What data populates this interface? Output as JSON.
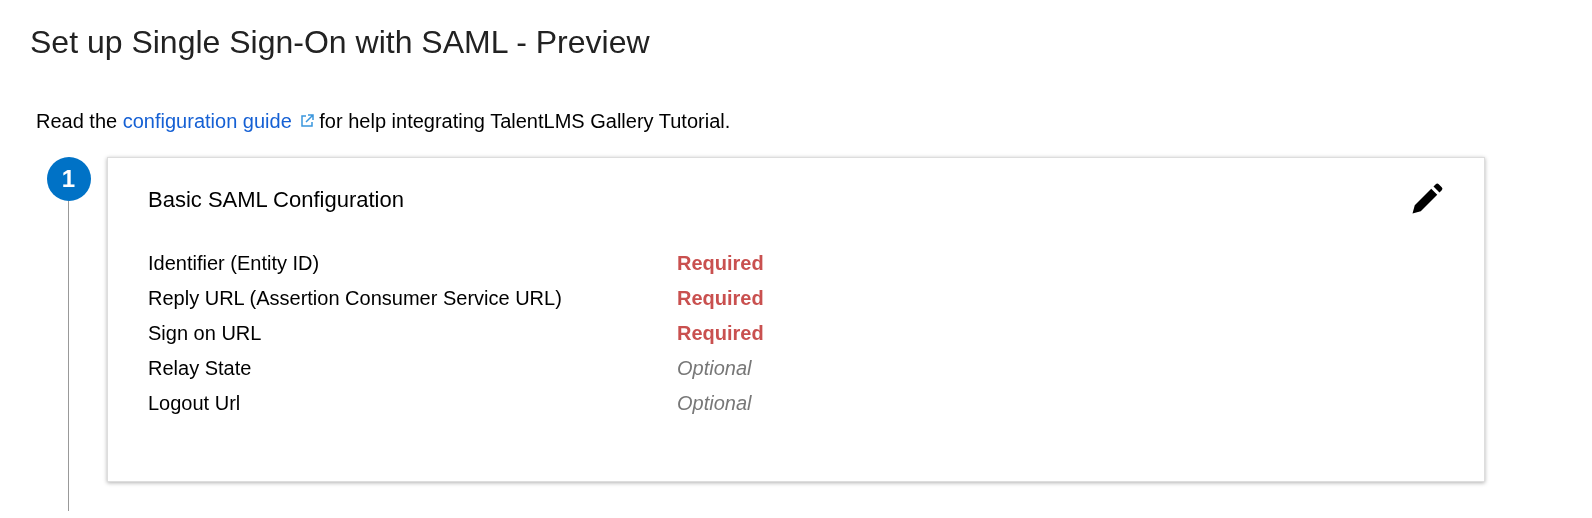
{
  "page_title": "Set up Single Sign-On with SAML - Preview",
  "intro": {
    "before": "Read the",
    "link": "configuration guide",
    "after": "for help integrating TalentLMS Gallery Tutorial."
  },
  "steps": [
    {
      "number": "1",
      "title": "Basic SAML Configuration",
      "rows": [
        {
          "label": "Identifier (Entity ID)",
          "status": "Required",
          "kind": "required"
        },
        {
          "label": "Reply URL (Assertion Consumer Service URL)",
          "status": "Required",
          "kind": "required"
        },
        {
          "label": "Sign on URL",
          "status": "Required",
          "kind": "required"
        },
        {
          "label": "Relay State",
          "status": "Optional",
          "kind": "optional"
        },
        {
          "label": "Logout Url",
          "status": "Optional",
          "kind": "optional"
        }
      ]
    }
  ]
}
